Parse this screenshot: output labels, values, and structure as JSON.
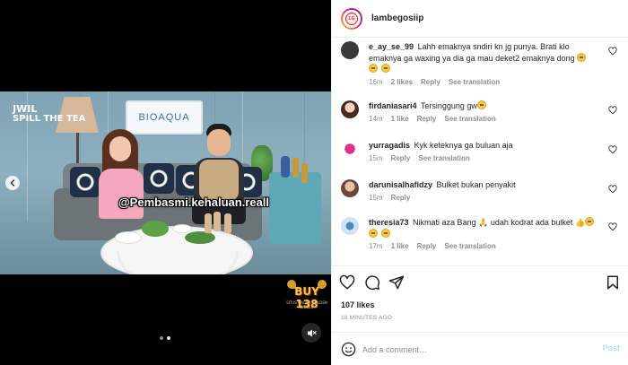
{
  "post": {
    "username": "lambegosiip",
    "likes": "107 likes",
    "time": "18 MINUTES AGO"
  },
  "video": {
    "overlay_text": "@Pembasmi.kehaluan.reall",
    "show_logo_line1": "JWIL",
    "show_logo_line2": "SPILL THE TEA",
    "sign_text": "BIOAQUA",
    "brand_badge": "BUY 138",
    "brand_badge_sub": "SITUS GACOR GOLDEN WORLD"
  },
  "comments": [
    {
      "username": "e_ay_se_99",
      "text": "Lahh emaknya sndiri kn jg punya. Brati klo emaknya ga waxing ya dia ga mau deket2 emaknya dong",
      "emoji_inline": "😂",
      "emoji_line": "😂😂",
      "time": "16m",
      "likes": "2 likes",
      "reply": "Reply",
      "translate": "See translation",
      "avatar_color": "#3a3a3a"
    },
    {
      "username": "firdaniasari4",
      "text": "Tersinggung gw",
      "emoji_inline": "😂",
      "time": "14m",
      "likes": "1 like",
      "reply": "Reply",
      "translate": "See translation",
      "avatar_color": "#c98b7a"
    },
    {
      "username": "yurragadis",
      "text": "Kyk keteknya ga buluan aja",
      "time": "15m",
      "reply": "Reply",
      "translate": "See translation",
      "avatar_color": "#e0348a"
    },
    {
      "username": "darunisalhafidzy",
      "text": "Bulket bukan penyakit",
      "time": "15m",
      "reply": "Reply",
      "avatar_color": "#b07a5a"
    },
    {
      "username": "theresia73",
      "text": "Nikmati aza Bang",
      "text2": "udah kodrat ada bulket",
      "emoji_line": "😂😂",
      "time": "17m",
      "likes": "1 like",
      "reply": "Reply",
      "translate": "See translation",
      "avatar_color": "#4a8bc2"
    }
  ],
  "add_comment": {
    "placeholder": "Add a comment…",
    "post_label": "Post"
  },
  "colors": {
    "link_blue_disabled": "#b2dffc",
    "meta_gray": "#8e8e8e",
    "text": "#262626"
  }
}
